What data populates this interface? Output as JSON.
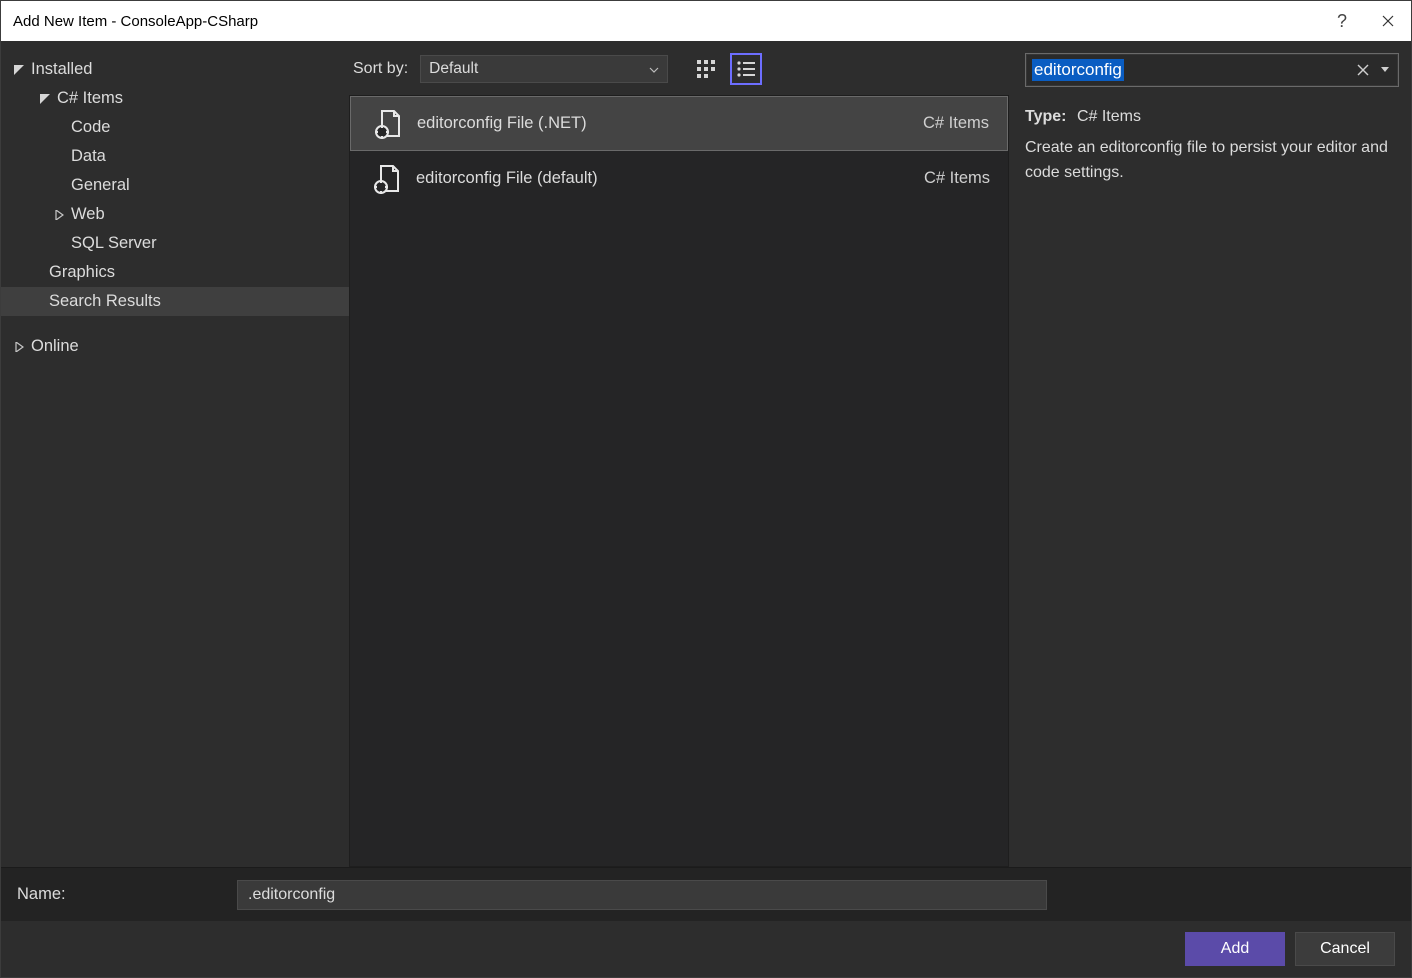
{
  "titlebar": {
    "title": "Add New Item - ConsoleApp-CSharp"
  },
  "sidebar": {
    "installed": "Installed",
    "csitems": "C# Items",
    "code": "Code",
    "data": "Data",
    "general": "General",
    "web": "Web",
    "sqlserver": "SQL Server",
    "graphics": "Graphics",
    "searchresults": "Search Results",
    "online": "Online"
  },
  "toolbar": {
    "sortby_label": "Sort by:",
    "sortby_value": "Default"
  },
  "templates": [
    {
      "label": "editorconfig File (.NET)",
      "category": "C# Items",
      "selected": true
    },
    {
      "label": "editorconfig File (default)",
      "category": "C# Items",
      "selected": false
    }
  ],
  "search": {
    "value": "editorconfig"
  },
  "details": {
    "type_label": "Type:",
    "type_value": "C# Items",
    "description": "Create an editorconfig file to persist your editor and code settings."
  },
  "namebar": {
    "label": "Name:",
    "value": ".editorconfig"
  },
  "footer": {
    "add": "Add",
    "cancel": "Cancel"
  }
}
